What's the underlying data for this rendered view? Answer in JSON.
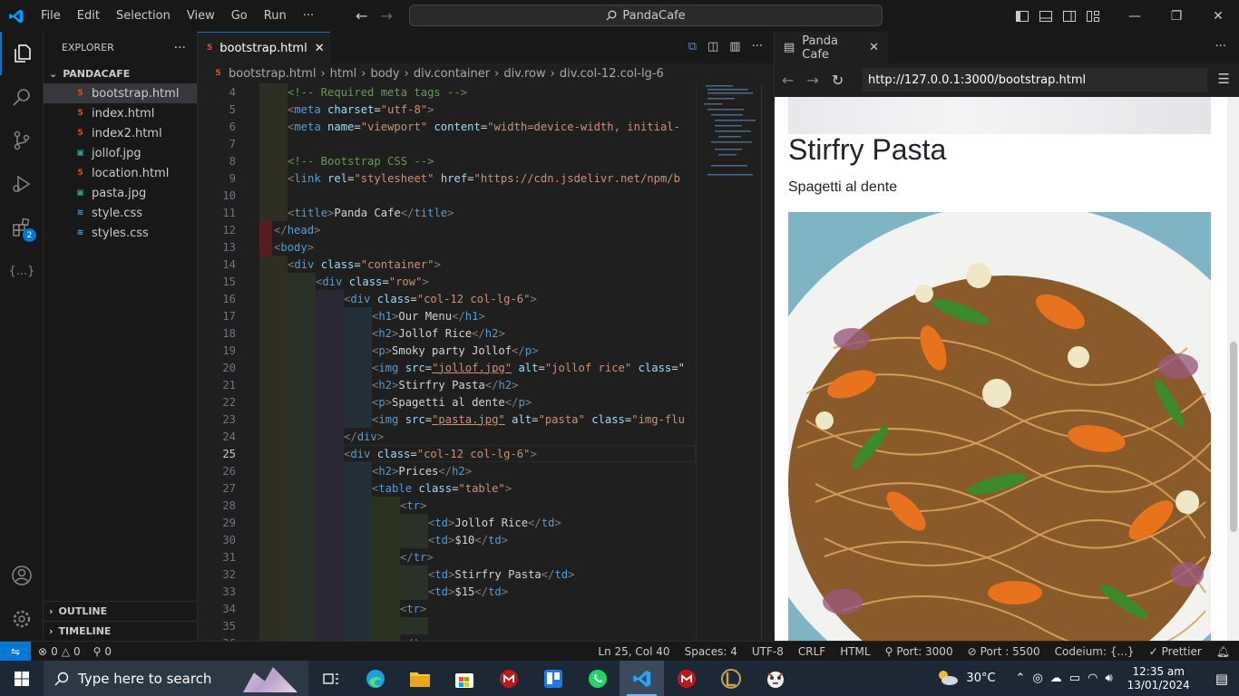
{
  "titlebar": {
    "menu": [
      "File",
      "Edit",
      "Selection",
      "View",
      "Go",
      "Run",
      "···"
    ],
    "search_text": "PandaCafe",
    "window_buttons": {
      "minimize": "—",
      "restore": "❐",
      "close": "✕"
    }
  },
  "sidebar": {
    "title": "EXPLORER",
    "more": "···",
    "folder": "PANDACAFE",
    "files": [
      {
        "name": "bootstrap.html",
        "type": "html"
      },
      {
        "name": "index.html",
        "type": "html"
      },
      {
        "name": "index2.html",
        "type": "html"
      },
      {
        "name": "jollof.jpg",
        "type": "img"
      },
      {
        "name": "location.html",
        "type": "html"
      },
      {
        "name": "pasta.jpg",
        "type": "img"
      },
      {
        "name": "style.css",
        "type": "css"
      },
      {
        "name": "styles.css",
        "type": "css"
      }
    ],
    "outline": "OUTLINE",
    "timeline": "TIMELINE"
  },
  "activity": {
    "extensions_badge": "2",
    "remote_label": "{...}"
  },
  "editor": {
    "tab_label": "bootstrap.html",
    "breadcrumbs": [
      "bootstrap.html",
      "html",
      "body",
      "div.container",
      "div.row",
      "div.col-12.col-lg-6"
    ],
    "current_line": "25"
  },
  "preview": {
    "tab_label": "Panda Cafe",
    "url": "http://127.0.0.1:3000/bootstrap.html",
    "heading": "Stirfry Pasta",
    "paragraph": "Spagetti al dente"
  },
  "statusbar": {
    "problems": "0",
    "warnings": "0",
    "ports": "0",
    "position": "Ln 25, Col 40",
    "spaces": "Spaces: 4",
    "encoding": "UTF-8",
    "eol": "CRLF",
    "language": "HTML",
    "port": "Port: 3000",
    "port2": "Port : 5500",
    "codeium": "Codeium: {...}",
    "prettier": "Prettier"
  },
  "taskbar": {
    "search_placeholder": "Type here to search",
    "temperature": "30°C",
    "time": "12:35 am",
    "date": "13/01/2024"
  },
  "colors": {
    "accent": "#0078d4",
    "tag": "#569cd6",
    "attr": "#9cdcfe",
    "string": "#ce9178",
    "comment": "#6a9955"
  }
}
